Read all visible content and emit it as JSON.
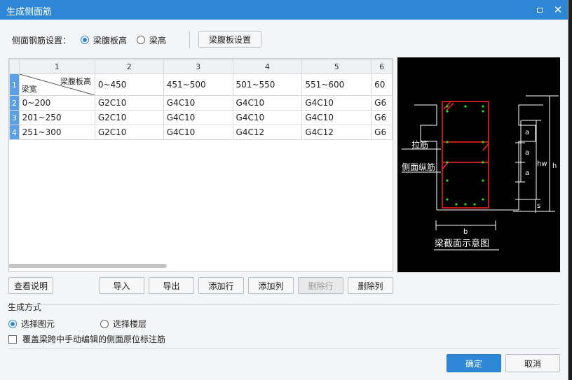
{
  "window": {
    "title": "生成侧面筋"
  },
  "settings": {
    "label": "侧面钢筋设置：",
    "option1": "梁腹板高",
    "option2": "梁高",
    "button": "梁腹板设置"
  },
  "table": {
    "col_numbers": [
      "1",
      "2",
      "3",
      "4",
      "5",
      "6"
    ],
    "row_numbers": [
      "1",
      "2",
      "3",
      "4"
    ],
    "corner_top": "梁腹板高",
    "corner_bottom": "梁宽",
    "header": [
      "0~450",
      "451~500",
      "501~550",
      "551~600",
      "60"
    ],
    "rows": [
      {
        "label": "0~200",
        "cells": [
          "G2C10",
          "G4C10",
          "G4C10",
          "G4C10",
          "G6"
        ]
      },
      {
        "label": "201~250",
        "cells": [
          "G2C10",
          "G4C10",
          "G4C10",
          "G4C10",
          "G6"
        ]
      },
      {
        "label": "251~300",
        "cells": [
          "G2C10",
          "G4C10",
          "G4C12",
          "G4C12",
          "G6"
        ]
      }
    ]
  },
  "diagram": {
    "caption": "梁截面示意图",
    "tie_label": "拉筋",
    "side_label": "侧面纵筋",
    "dim_a": "a",
    "dim_hw": "hw",
    "dim_h": "h",
    "dim_s": "s",
    "dim_b": "b"
  },
  "buttons": {
    "view_help": "查看说明",
    "import": "导入",
    "export": "导出",
    "add_row": "添加行",
    "add_col": "添加列",
    "del_row": "删除行",
    "del_col": "删除列"
  },
  "mode": {
    "section": "生成方式",
    "option1": "选择图元",
    "option2": "选择楼层",
    "checkbox": "覆盖梁跨中手动编辑的侧面原位标注筋"
  },
  "footer": {
    "ok": "确定",
    "cancel": "取消"
  }
}
